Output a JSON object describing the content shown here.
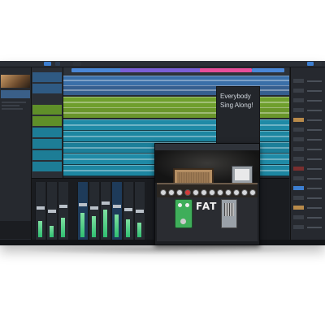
{
  "colors": {
    "accent_blue": "#3d7fd1",
    "track_cyan": "#2aa6c8",
    "track_green": "#8fc13a",
    "marker_pink": "#e64e9a",
    "marker_purple": "#7a5fd6",
    "panel_dark": "#1f2227"
  },
  "arrangement": {
    "note_text": "Everybody Sing Along!"
  },
  "plugin": {
    "pedal_label": "FAT"
  },
  "icons": [
    "play-icon",
    "record-icon",
    "stop-icon",
    "knob-icon",
    "speaker-cabinet-icon",
    "amp-head-icon"
  ]
}
